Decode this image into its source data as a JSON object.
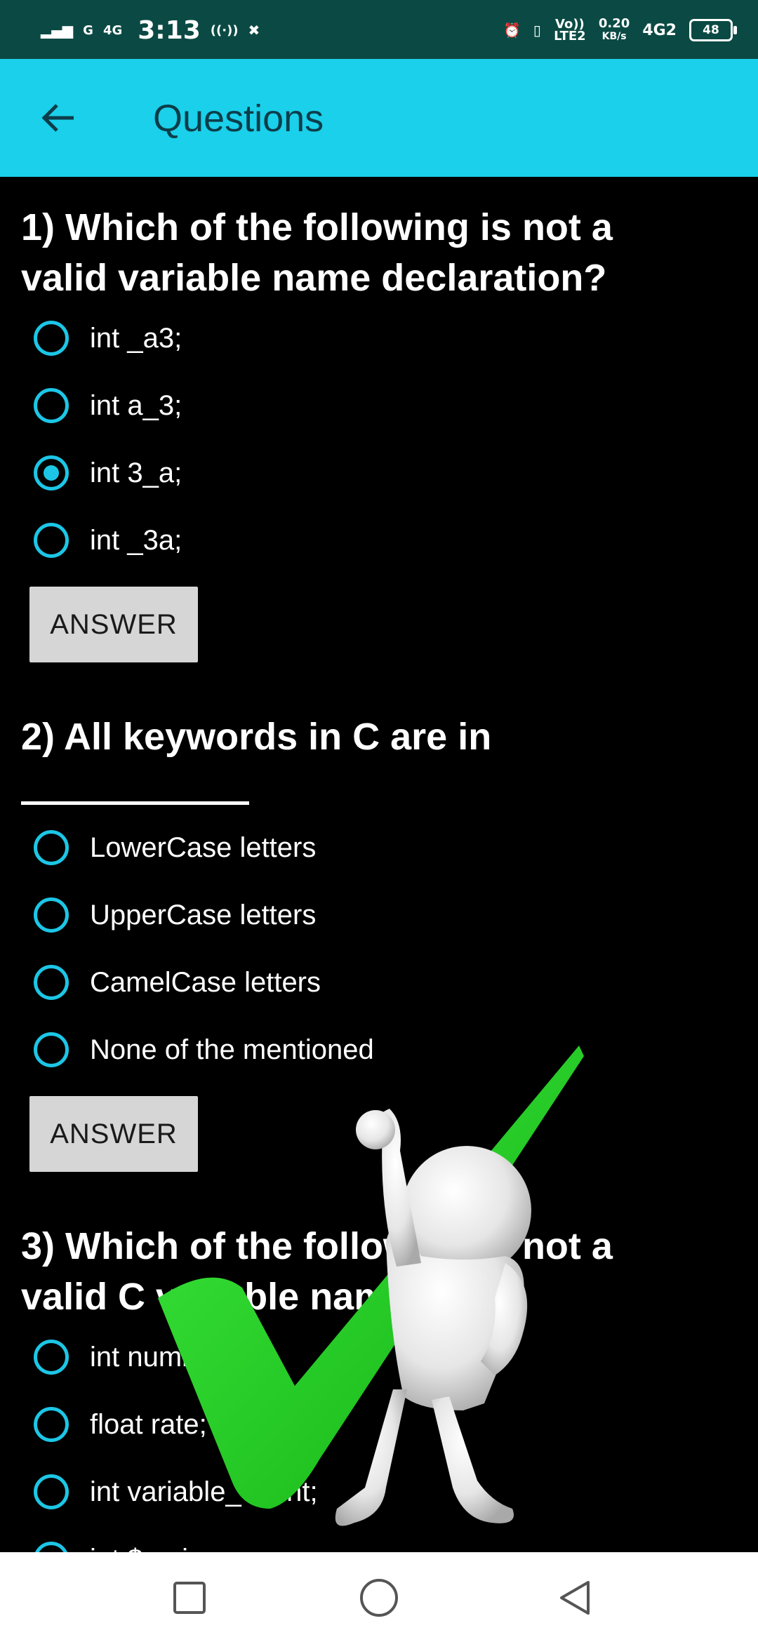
{
  "status_bar": {
    "network_left": "G",
    "network_4g": "4G",
    "time": "3:13",
    "volte": "Vo)) LTE2",
    "speed_value": "0.20",
    "speed_unit": "KB/s",
    "network_right": "4G2",
    "battery": "48"
  },
  "app_bar": {
    "title": "Questions",
    "back_icon": "arrow-back-icon"
  },
  "questions": [
    {
      "title": "1) Which of the following is not a valid variable name declaration?",
      "options": [
        "int _a3;",
        "int a_3;",
        "int 3_a;",
        "int _3a;"
      ],
      "selected": 2,
      "answer_label": "ANSWER"
    },
    {
      "title": "2) All keywords in C are in",
      "options": [
        "LowerCase letters",
        "UpperCase letters",
        "CamelCase letters",
        "None of the mentioned"
      ],
      "selected": -1,
      "answer_label": "ANSWER"
    },
    {
      "title": "3) Which of the following is not a valid C variable name?",
      "options": [
        "int number;",
        "float rate;",
        "int variable_count;",
        "int $main;"
      ],
      "selected": -1
    }
  ],
  "nav_bar": {
    "recents_icon": "square-icon",
    "home_icon": "circle-icon",
    "back_icon": "triangle-back-icon"
  },
  "colors": {
    "app_bar": "#1ad0ea",
    "status_bar": "#0b4a44",
    "radio": "#1cc6e6",
    "button": "#d6d6d6",
    "checkmark": "#22cc22"
  }
}
